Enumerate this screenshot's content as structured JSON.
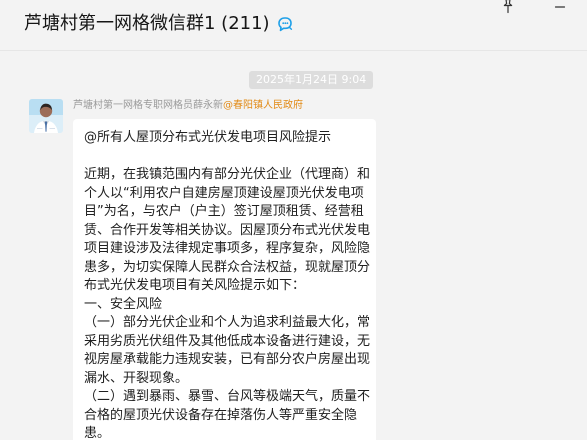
{
  "header": {
    "title": "芦塘村第一网格微信群1 (211)",
    "chat_icon": "chat-bubble-icon",
    "pin_icon": "pin-icon",
    "minimize_icon": "minimize-icon"
  },
  "conversation": {
    "timestamp": "2025年1月24日 9:04",
    "message": {
      "sender": "芦塘村第一网格专职网格员薛永新",
      "sender_tag": "@春阳镇人民政府",
      "avatar": "avatar-person-icon",
      "lines": [
        "@所有人屋顶分布式光伏发电项目风险提示",
        "",
        "近期，在我镇范围内有部分光伏企业（代理商）和个人以“利用农户自建房屋顶建设屋顶光伏发电项目”为名，与农户（户主）签订屋顶租赁、经营租赁、合作开发等相关协议。因屋顶分布式光伏发电项目建设涉及法律规定事项多，程序复杂，风险隐患多，为切实保障人民群众合法权益，现就屋顶分布式光伏发电项目有关风险提示如下：",
        "一、安全风险",
        "（一）部分光伏企业和个人为追求利益最大化，常采用劣质光伏组件及其他低成本设备进行建设，无视房屋承载能力违规安装，已有部分农户房屋出现漏水、开裂现象。",
        "（二）遇到暴雨、暴雪、台风等极端天气，质量不合格的屋顶光伏设备存在掉落伤人等严重安全隐患。"
      ]
    }
  },
  "colors": {
    "background": "#f3f3f3",
    "bubble": "#ffffff",
    "timestamp_bg": "#dddddd",
    "sender_tag": "#e28b17",
    "chat_icon": "#1fa0e8"
  }
}
